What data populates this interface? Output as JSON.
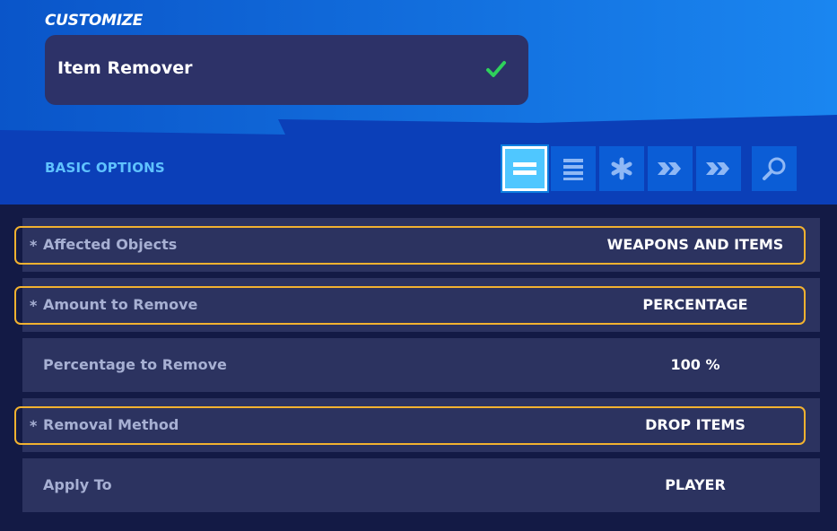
{
  "header": {
    "section_label": "CUSTOMIZE",
    "item_title": "Item Remover",
    "item_status_icon": "check-icon",
    "check_color": "#2ed15b"
  },
  "options": {
    "section_title": "BASIC OPTIONS",
    "tabs": [
      {
        "icon": "basic-options-icon",
        "active": true
      },
      {
        "icon": "all-options-icon",
        "active": false
      },
      {
        "icon": "modified-options-icon",
        "active": false
      },
      {
        "icon": "fast-forward-icon",
        "active": false
      },
      {
        "icon": "fast-forward-alt-icon",
        "active": false
      },
      {
        "icon": "search-icon",
        "active": false
      }
    ],
    "rows": [
      {
        "label": "Affected Objects",
        "value": "WEAPONS AND ITEMS",
        "modified": true,
        "highlighted": true
      },
      {
        "label": "Amount to Remove",
        "value": "PERCENTAGE",
        "modified": true,
        "highlighted": true
      },
      {
        "label": "Percentage to Remove",
        "value": "100 %",
        "modified": false,
        "highlighted": false
      },
      {
        "label": "Removal Method",
        "value": "DROP ITEMS",
        "modified": true,
        "highlighted": true
      },
      {
        "label": "Apply To",
        "value": "PLAYER",
        "modified": false,
        "highlighted": false
      }
    ],
    "modified_marker": "*",
    "highlight_color": "#f2b230"
  }
}
